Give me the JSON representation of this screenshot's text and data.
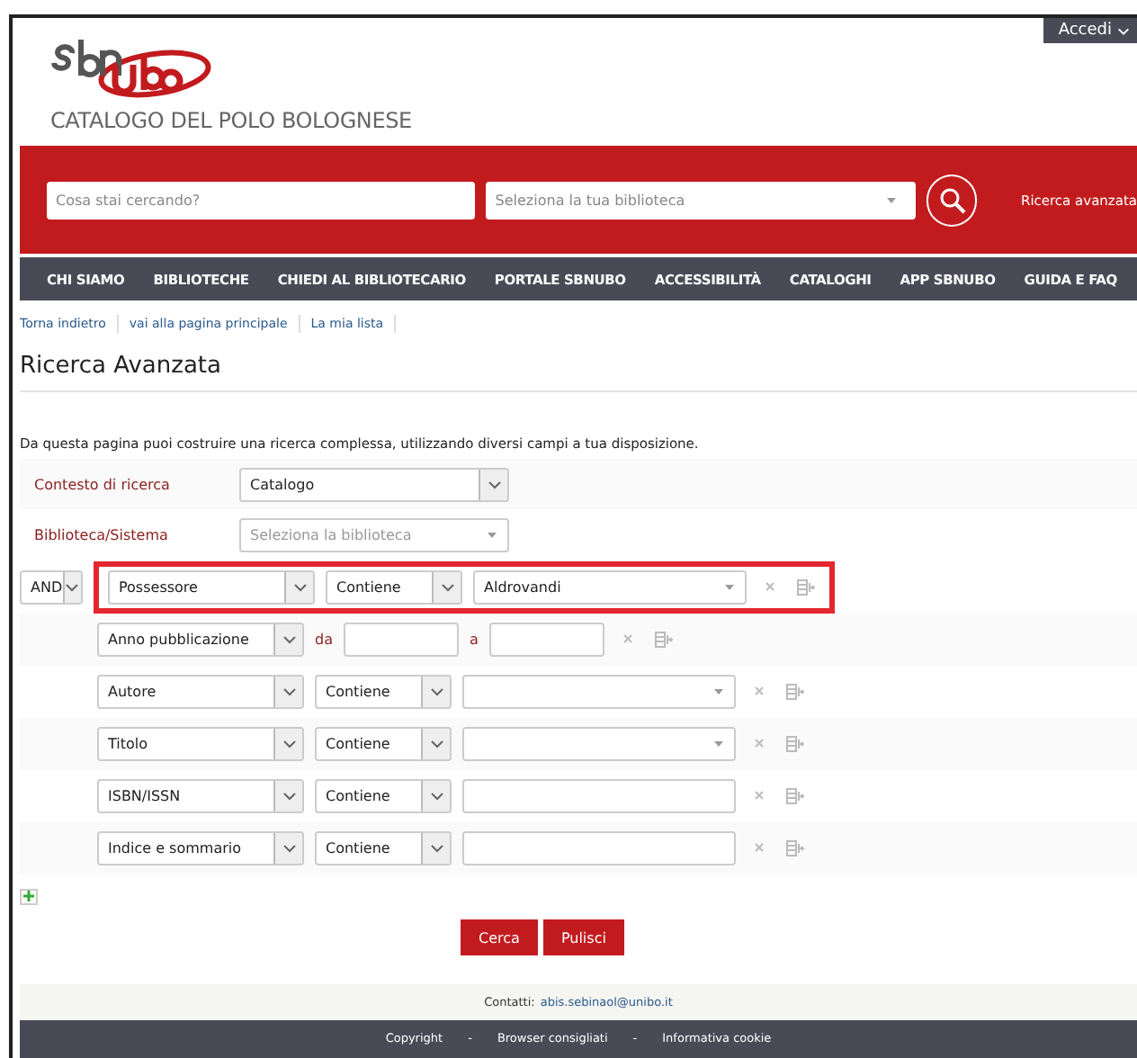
{
  "account_menu": {
    "label": "Accedi"
  },
  "logo": {
    "subtitle": "CATALOGO DEL POLO BOLOGNESE"
  },
  "search_bar": {
    "query": {
      "placeholder": "Cosa stai cercando?"
    },
    "library": {
      "placeholder": "Seleziona la tua biblioteca"
    },
    "advanced_link": "Ricerca avanzata"
  },
  "nav": [
    "CHI SIAMO",
    "BIBLIOTECHE",
    "CHIEDI AL BIBLIOTECARIO",
    "PORTALE SBNUBO",
    "ACCESSIBILITÀ",
    "CATALOGHI",
    "APP SBNUBO",
    "GUIDA E FAQ"
  ],
  "breadcrumbs": [
    "Torna indietro",
    "vai alla pagina principale",
    "La mia lista"
  ],
  "page_title": "Ricerca Avanzata",
  "intro": "Da questa pagina puoi costruire una ricerca complessa, utilizzando diversi campi a tua disposizione.",
  "context": {
    "label": "Contesto di ricerca",
    "value": "Catalogo"
  },
  "library": {
    "label": "Biblioteca/Sistema",
    "placeholder": "Seleziona la biblioteca"
  },
  "criteria": [
    {
      "kind": "lookup",
      "connector": "AND",
      "field": "Possessore",
      "operator": "Contiene",
      "value": "Aldrovandi",
      "highlighted": true
    },
    {
      "kind": "range",
      "field": "Anno pubblicazione",
      "from_label": "da",
      "to_label": "a",
      "highlighted": false
    },
    {
      "kind": "lookup",
      "field": "Autore",
      "operator": "Contiene",
      "highlighted": false
    },
    {
      "kind": "lookup",
      "field": "Titolo",
      "operator": "Contiene",
      "highlighted": false
    },
    {
      "kind": "text",
      "field": "ISBN/ISSN",
      "operator": "Contiene",
      "highlighted": false
    },
    {
      "kind": "text",
      "field": "Indice e sommario",
      "operator": "Contiene",
      "highlighted": false
    }
  ],
  "buttons": [
    "Cerca",
    "Pulisci"
  ],
  "contact": {
    "label": "Contatti:",
    "email": "abis.sebinaol@unibo.it"
  },
  "footer_links": [
    "Copyright",
    "Browser consigliati",
    "Informativa cookie"
  ],
  "footer_separator": "-"
}
